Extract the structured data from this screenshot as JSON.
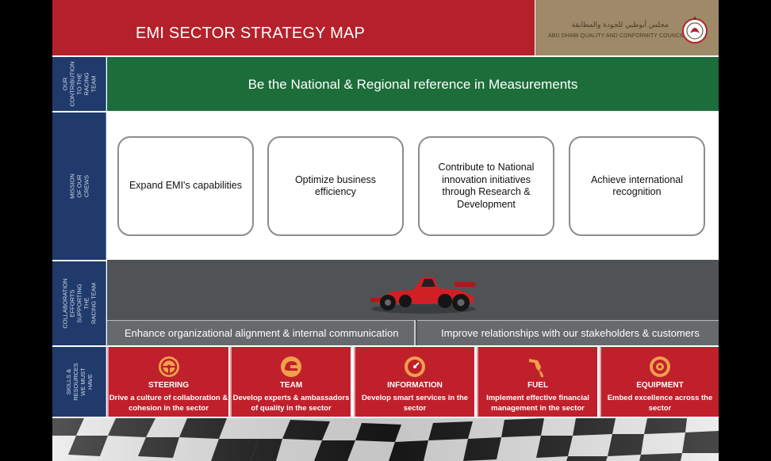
{
  "header": {
    "title": "EMI SECTOR STRATEGY MAP",
    "logo_arabic": "مجلس أبوظبي للجودة والمطابقة",
    "logo_english": "ABU DHABI QUALITY AND CONFORMITY COUNCIL"
  },
  "side_labels": [
    "OUR\nCONTRIBUTION\nTO THE RACING\nTEAM",
    "MISSION OF OUR CREWS",
    "COLLABORATION\nEFFORTS\nSUPPORTING THE\nRACING TEAM",
    "SKILLS &\nRESOURCES\nWE MUST HAVE"
  ],
  "vision": "Be the National & Regional reference in Measurements",
  "missions": [
    "Expand EMI's capabilities",
    "Optimize business efficiency",
    "Contribute to National innovation initiatives through Research & Development",
    "Achieve international recognition"
  ],
  "collaboration": [
    "Enhance organizational alignment & internal communication",
    "Improve relationships with our stakeholders & customers"
  ],
  "skills": [
    {
      "title": "STEERING",
      "desc": "Drive a culture of collaboration & cohesion in the sector",
      "icon": "steering-wheel-icon"
    },
    {
      "title": "TEAM",
      "desc": "Develop experts & ambassadors of quality in the sector",
      "icon": "helmet-icon"
    },
    {
      "title": "INFORMATION",
      "desc": "Develop smart services in the sector",
      "icon": "speedometer-icon"
    },
    {
      "title": "FUEL",
      "desc": "Implement effective financial management in the sector",
      "icon": "fuel-nozzle-icon"
    },
    {
      "title": "EQUIPMENT",
      "desc": "Embed excellence across the sector",
      "icon": "wheel-icon"
    }
  ],
  "colors": {
    "title_red": "#b5212a",
    "skill_red": "#c0202b",
    "vision_green": "#1d6d3a",
    "side_navy": "#1f3a6b",
    "logo_gold": "#9e8a68",
    "road_grey": "#4f5355"
  }
}
